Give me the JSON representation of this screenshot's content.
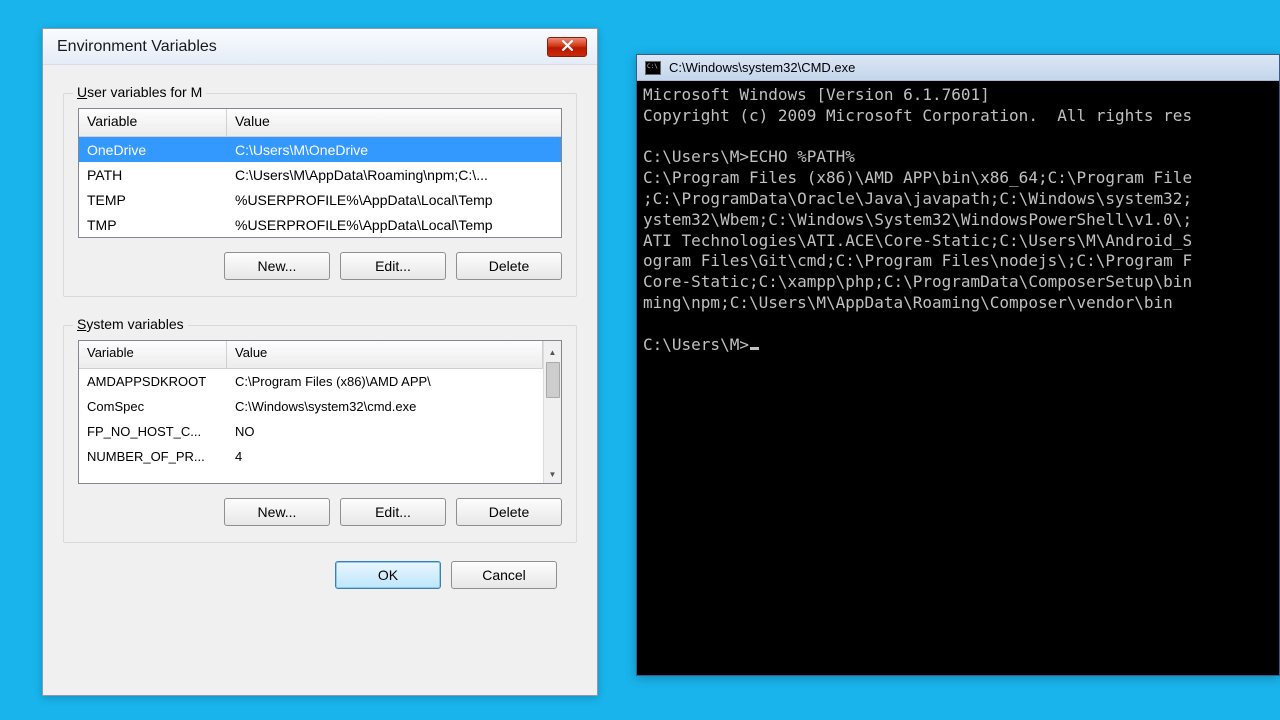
{
  "env_dialog": {
    "title": "Environment Variables",
    "user_section_prefix": "U",
    "user_section_label": "ser variables for M",
    "system_section_prefix": "S",
    "system_section_label": "ystem variables",
    "columns": {
      "variable": "Variable",
      "value": "Value"
    },
    "user_vars": [
      {
        "name": "OneDrive",
        "value": "C:\\Users\\M\\OneDrive",
        "selected": true
      },
      {
        "name": "PATH",
        "value": "C:\\Users\\M\\AppData\\Roaming\\npm;C:\\...",
        "selected": false
      },
      {
        "name": "TEMP",
        "value": "%USERPROFILE%\\AppData\\Local\\Temp",
        "selected": false
      },
      {
        "name": "TMP",
        "value": "%USERPROFILE%\\AppData\\Local\\Temp",
        "selected": false
      }
    ],
    "system_vars": [
      {
        "name": "AMDAPPSDKROOT",
        "value": "C:\\Program Files (x86)\\AMD APP\\"
      },
      {
        "name": "ComSpec",
        "value": "C:\\Windows\\system32\\cmd.exe"
      },
      {
        "name": "FP_NO_HOST_C...",
        "value": "NO"
      },
      {
        "name": "NUMBER_OF_PR...",
        "value": "4"
      }
    ],
    "buttons": {
      "new": "New...",
      "edit": "Edit...",
      "delete": "Delete",
      "ok": "OK",
      "cancel": "Cancel"
    }
  },
  "cmd": {
    "title": "C:\\Windows\\system32\\CMD.exe",
    "lines": [
      "Microsoft Windows [Version 6.1.7601]",
      "Copyright (c) 2009 Microsoft Corporation.  All rights res",
      "",
      "C:\\Users\\M>ECHO %PATH%",
      "C:\\Program Files (x86)\\AMD APP\\bin\\x86_64;C:\\Program File",
      ";C:\\ProgramData\\Oracle\\Java\\javapath;C:\\Windows\\system32;",
      "ystem32\\Wbem;C:\\Windows\\System32\\WindowsPowerShell\\v1.0\\;",
      "ATI Technologies\\ATI.ACE\\Core-Static;C:\\Users\\M\\Android_S",
      "ogram Files\\Git\\cmd;C:\\Program Files\\nodejs\\;C:\\Program F",
      "Core-Static;C:\\xampp\\php;C:\\ProgramData\\ComposerSetup\\bin",
      "ming\\npm;C:\\Users\\M\\AppData\\Roaming\\Composer\\vendor\\bin",
      "",
      "C:\\Users\\M>"
    ]
  }
}
